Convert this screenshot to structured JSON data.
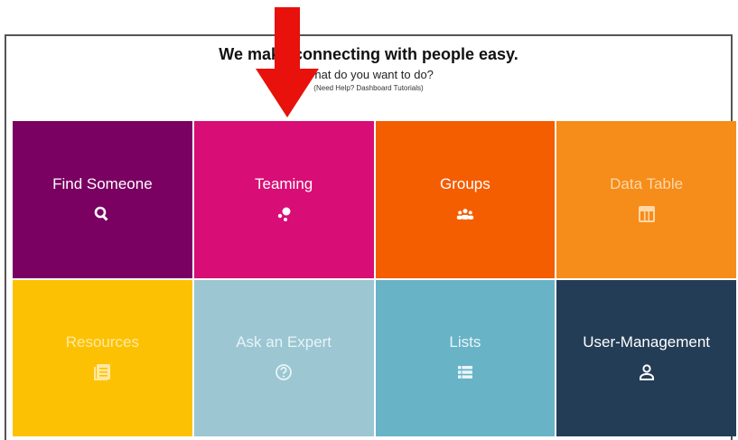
{
  "header": {
    "headline": "We make connecting with people easy.",
    "subline": "What do you want to do?",
    "help": "(Need Help? Dashboard Tutorials)"
  },
  "tiles": [
    {
      "label": "Find Someone",
      "icon": "search-icon",
      "color": "#7a0062"
    },
    {
      "label": "Teaming",
      "icon": "teaming-icon",
      "color": "#d80d75"
    },
    {
      "label": "Groups",
      "icon": "group-icon",
      "color": "#f45d00"
    },
    {
      "label": "Data Table",
      "icon": "table-icon",
      "color": "#f68c1a"
    },
    {
      "label": "Resources",
      "icon": "document-icon",
      "color": "#fdc104"
    },
    {
      "label": "Ask an Expert",
      "icon": "question-icon",
      "color": "#9bc6d2"
    },
    {
      "label": "Lists",
      "icon": "list-icon",
      "color": "#69b3c7"
    },
    {
      "label": "User-Management",
      "icon": "user-icon",
      "color": "#233d56"
    }
  ],
  "annotation": {
    "arrow_color": "#e8110c"
  }
}
